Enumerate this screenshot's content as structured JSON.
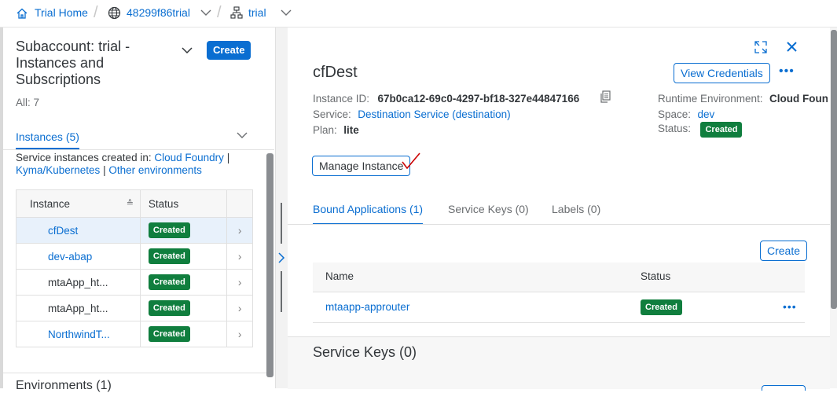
{
  "breadcrumb": {
    "home": "Trial Home",
    "globalaccount": "48299f86trial",
    "subaccount": "trial"
  },
  "left": {
    "title": "Subaccount: trial - Instances and Subscriptions",
    "count": "All: 7",
    "create_label": "Create",
    "section_title": "Instances (5)",
    "created_in_prefix": "Service instances created in:",
    "env_cf": "Cloud Foundry",
    "pipe": "|",
    "env_kyma": "Kyma/Kubernetes",
    "env_other": "Other environments",
    "columns": {
      "instance": "Instance",
      "status": "Status"
    },
    "rows": [
      {
        "name": "cfDest",
        "status": "Created"
      },
      {
        "name": "dev-abap",
        "status": "Created"
      },
      {
        "name": "mtaApp_ht...",
        "status": "Created"
      },
      {
        "name": "mtaApp_ht...",
        "status": "Created"
      },
      {
        "name": "NorthwindT...",
        "status": "Created"
      }
    ],
    "next_section": "Environments (1)"
  },
  "detail": {
    "title": "cfDest",
    "view_credentials": "View Credentials",
    "instance_id_label": "Instance ID:",
    "instance_id": "67b0ca12-69c0-4297-bf18-327e44847166",
    "service_label": "Service:",
    "service": "Destination Service (destination)",
    "plan_label": "Plan:",
    "plan": "lite",
    "runtime_label": "Runtime Environment:",
    "runtime": "Cloud Foundry",
    "space_label": "Space:",
    "space": "dev",
    "status_label": "Status:",
    "status": "Created",
    "manage_instance": "Manage Instance",
    "tabs": [
      "Bound Applications (1)",
      "Service Keys (0)",
      "Labels (0)"
    ],
    "bound_create": "Create",
    "bound_columns": {
      "name": "Name",
      "status": "Status"
    },
    "bound_rows": [
      {
        "name": "mtaapp-approuter",
        "status": "Created"
      }
    ],
    "service_keys_title": "Service Keys (0)"
  },
  "colors": {
    "accent": "#0a6ed1",
    "success": "#107e3e",
    "annotation": "#cc0000"
  }
}
